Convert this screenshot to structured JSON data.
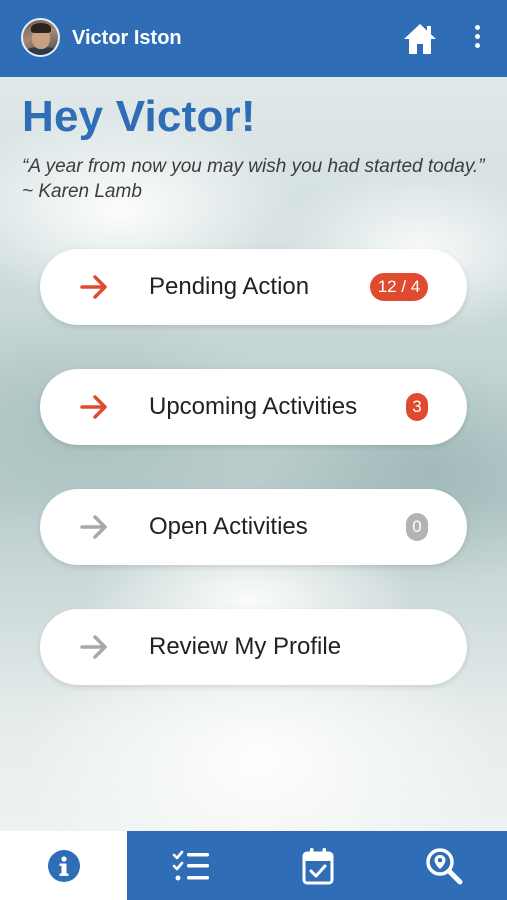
{
  "header": {
    "user_name": "Victor Iston",
    "home_icon": "home-icon",
    "menu_icon": "more-vertical-icon"
  },
  "greeting": "Hey Victor!",
  "quote": {
    "text": "“A year from now you may wish you had started today.”",
    "author": "~ Karen Lamb"
  },
  "actions": [
    {
      "label": "Pending Action",
      "badge": "12 / 4",
      "arrow_color": "#e04b2f",
      "badge_color": "#e04b2f"
    },
    {
      "label": "Upcoming Activities",
      "badge": "3",
      "arrow_color": "#e04b2f",
      "badge_color": "#e04b2f"
    },
    {
      "label": "Open Activities",
      "badge": "0",
      "arrow_color": "#a8a8a8",
      "badge_color": "#b3b3b3"
    },
    {
      "label": "Review My Profile",
      "badge": null,
      "arrow_color": "#a8a8a8"
    }
  ],
  "bottom_nav": [
    {
      "icon": "info-icon",
      "active": true
    },
    {
      "icon": "checklist-icon",
      "active": false
    },
    {
      "icon": "calendar-check-icon",
      "active": false
    },
    {
      "icon": "search-location-icon",
      "active": false
    }
  ],
  "colors": {
    "primary": "#2f6db6",
    "accent": "#e04b2f",
    "muted": "#a8a8a8"
  }
}
